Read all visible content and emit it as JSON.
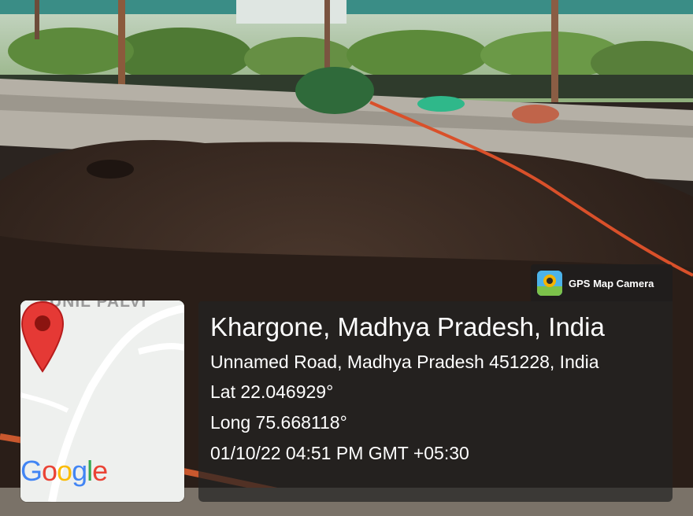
{
  "badge": {
    "label": "GPS Map Camera",
    "icon": "gps-map-camera-app-icon"
  },
  "location": {
    "title": "Khargone, Madhya Pradesh, India",
    "address": "Unnamed Road, Madhya Pradesh 451228, India",
    "lat": "Lat 22.046929°",
    "long": "Long 75.668118°",
    "datetime": "01/10/22 04:51 PM GMT +05:30"
  },
  "map": {
    "road_label": "SUNIL PALVI",
    "logo_text": "Google",
    "pin_color": "#e53935"
  },
  "colors": {
    "soil": "#3a2a22",
    "concrete": "#a8a49c",
    "panel": "#232323",
    "hose": "#d9502a"
  }
}
